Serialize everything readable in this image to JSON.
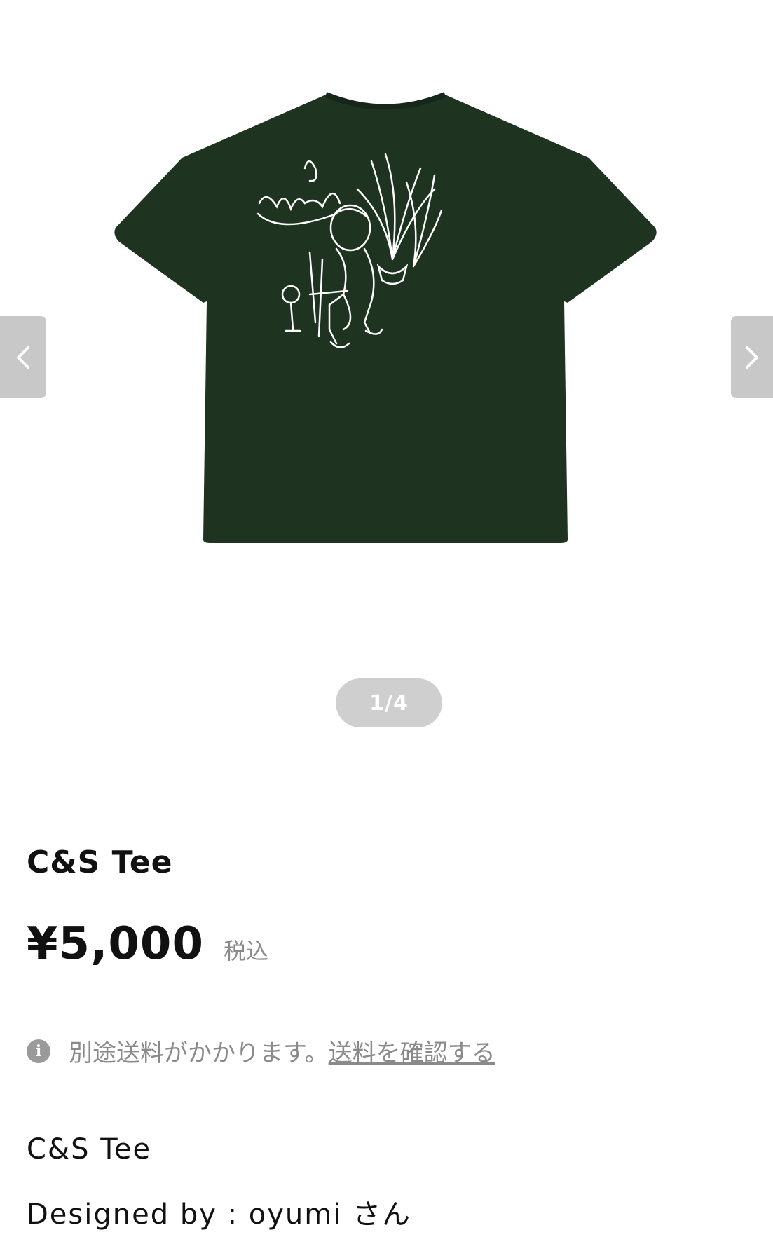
{
  "gallery": {
    "image_alt_icon": "tshirt-illustration",
    "shirt_color": "#1f3321",
    "print_color": "#ffffff",
    "counter": "1/4",
    "prev_icon": "chevron-left-icon",
    "next_icon": "chevron-right-icon"
  },
  "product": {
    "title": "C&S Tee",
    "price": "¥5,000",
    "tax_label": "税込",
    "shipping_note": "別途送料がかかります。",
    "shipping_link": "送料を確認する",
    "description_line1": "C&S Tee",
    "description_line2": "Designed by : oyumi さん"
  }
}
